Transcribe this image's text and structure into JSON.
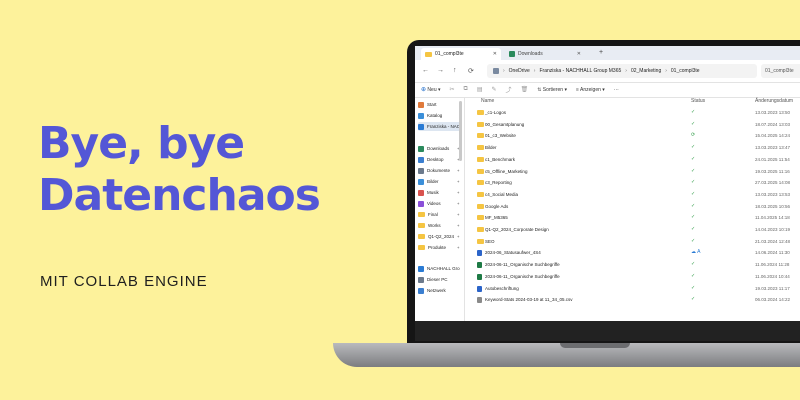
{
  "promo": {
    "headline_line1": "Bye, bye",
    "headline_line2": "Datenchaos",
    "subline": "MIT COLLAB ENGINE",
    "headline_color": "#5457d6",
    "background_color": "#fdf29b"
  },
  "explorer": {
    "tabs": [
      {
        "label": "01_compl3te",
        "active": true
      },
      {
        "label": "Downloads",
        "active": false
      }
    ],
    "breadcrumbs": [
      "OneDrive",
      "Franziska - NACHHALL Group M365",
      "02_Marketing",
      "01_compl3te"
    ],
    "search_placeholder": "01_compl3te",
    "toolbar": {
      "new_label": "Neu",
      "sort_label": "Sortieren",
      "view_label": "Anzeigen",
      "more_label": "···"
    },
    "sidebar": [
      {
        "label": "Start",
        "icon": "home-icon"
      },
      {
        "label": "Katalog",
        "icon": "gallery-icon"
      },
      {
        "label": "Franziska - NAC",
        "icon": "cloud-icon"
      },
      {
        "label": "Downloads",
        "icon": "download-icon"
      },
      {
        "label": "Desktop",
        "icon": "desktop-icon"
      },
      {
        "label": "Dokumente",
        "icon": "document-icon"
      },
      {
        "label": "Bilder",
        "icon": "pictures-icon"
      },
      {
        "label": "Musik",
        "icon": "music-icon"
      },
      {
        "label": "Videos",
        "icon": "video-icon"
      },
      {
        "label": "Final",
        "icon": "folder-icon"
      },
      {
        "label": "Works",
        "icon": "folder-icon"
      },
      {
        "label": "Q1-Q2_2024",
        "icon": "folder-icon"
      },
      {
        "label": "Produkte",
        "icon": "folder-icon"
      },
      {
        "label": "NACHHALL Gro",
        "icon": "cloud-icon"
      },
      {
        "label": "Dieser PC",
        "icon": "pc-icon"
      },
      {
        "label": "Netzwerk",
        "icon": "network-icon"
      }
    ],
    "columns": {
      "name": "Name",
      "status": "Status",
      "date": "Änderungsdatum"
    },
    "files": [
      {
        "name": "_c1-Logos",
        "status": "✓",
        "date": "13.03.2023 13:50",
        "type": "folder"
      },
      {
        "name": "00_Gesamtplanung",
        "status": "✓",
        "date": "18.07.2024 13:03",
        "type": "folder"
      },
      {
        "name": "01_c3_Website",
        "status": "⟳",
        "date": "15.04.2025 14:24",
        "type": "folder"
      },
      {
        "name": "Bilder",
        "status": "✓",
        "date": "13.03.2023 13:47",
        "type": "folder"
      },
      {
        "name": "c1_Benchmark",
        "status": "✓",
        "date": "24.01.2025 11:54",
        "type": "folder"
      },
      {
        "name": "c5_Offline_Marketing",
        "status": "✓",
        "date": "19.03.2025 11:16",
        "type": "folder"
      },
      {
        "name": "c3_Reporting",
        "status": "✓",
        "date": "27.03.2025 14:08",
        "type": "folder"
      },
      {
        "name": "c4_Social Media",
        "status": "✓",
        "date": "13.03.2023 13:53",
        "type": "folder"
      },
      {
        "name": "Google Ads",
        "status": "✓",
        "date": "18.03.2025 10:56",
        "type": "folder"
      },
      {
        "name": "MF_M5365",
        "status": "✓",
        "date": "11.04.2025 14:18",
        "type": "folder"
      },
      {
        "name": "Q1-Q2_2024_Corporate Design",
        "status": "✓",
        "date": "14.04.2023 10:19",
        "type": "folder"
      },
      {
        "name": "SEO",
        "status": "✓",
        "date": "21.03.2024 12:48",
        "type": "folder"
      },
      {
        "name": "2024-06_Statusaufwer_4S4",
        "status": "☁ A",
        "date": "14.06.2024 11:30",
        "type": "doc"
      },
      {
        "name": "2024-06-11_Organische Suchbegriffe",
        "status": "✓",
        "date": "11.06.2024 11:28",
        "type": "sheet"
      },
      {
        "name": "2024-06-11_Organische Suchbegriffe",
        "status": "✓",
        "date": "11.06.2024 10:44",
        "type": "sheet"
      },
      {
        "name": "Autobeschriftung",
        "status": "✓",
        "date": "19.03.2023 11:17",
        "type": "doc"
      },
      {
        "name": "Keyword-Stats 2024-03-19 at 11_34_05.csv",
        "status": "✓",
        "date": "06.03.2024 14:22",
        "type": "csv"
      }
    ]
  }
}
